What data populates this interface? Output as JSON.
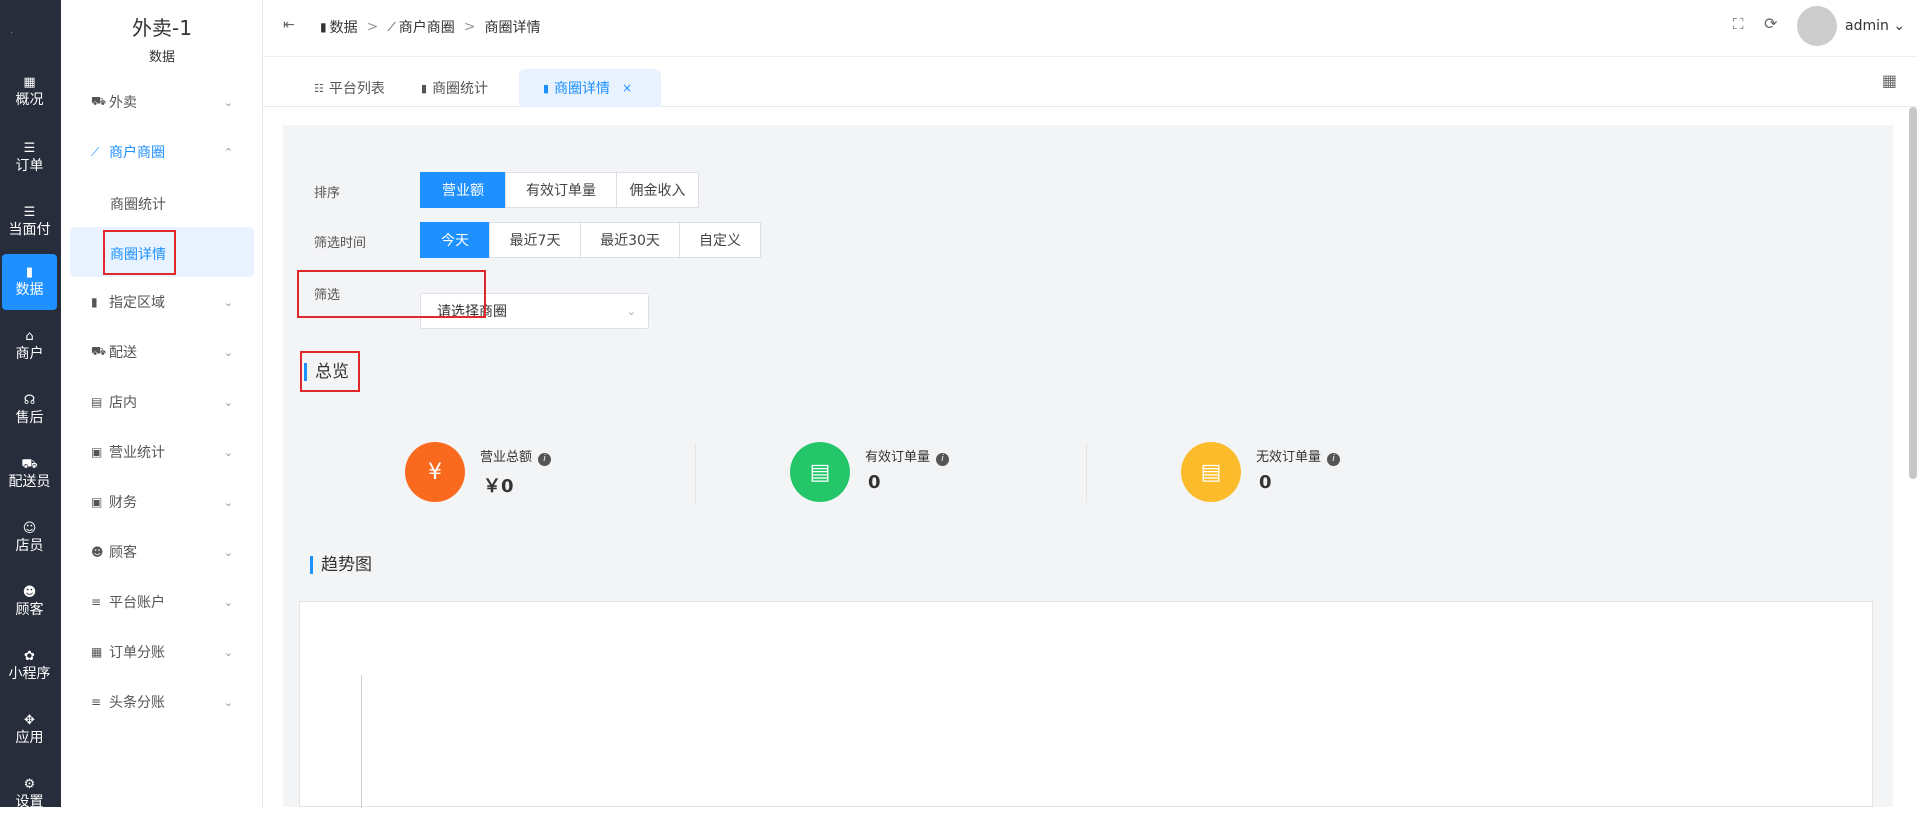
{
  "rail": {
    "items": [
      {
        "icon": "▦",
        "label": "概况"
      },
      {
        "icon": "☰",
        "label": "订单"
      },
      {
        "icon": "☰",
        "label": "当面付"
      },
      {
        "icon": "▮",
        "label": "数据"
      },
      {
        "icon": "⌂",
        "label": "商户"
      },
      {
        "icon": "☊",
        "label": "售后"
      },
      {
        "icon": "⛟",
        "label": "配送员"
      },
      {
        "icon": "☺",
        "label": "店员"
      },
      {
        "icon": "☻",
        "label": "顾客"
      },
      {
        "icon": "✿",
        "label": "小程序"
      },
      {
        "icon": "✥",
        "label": "应用"
      },
      {
        "icon": "⚙",
        "label": "设置"
      }
    ]
  },
  "sidebar": {
    "title": "外卖-1",
    "subtitle": "数据",
    "items": [
      {
        "icon": "⛟",
        "label": "外卖",
        "chevron": "⌄"
      },
      {
        "icon": "⟋",
        "label": "商户商圈",
        "chevron": "⌃"
      },
      {
        "icon": "▮",
        "label": "指定区域",
        "chevron": "⌄"
      },
      {
        "icon": "⛟",
        "label": "配送",
        "chevron": "⌄"
      },
      {
        "icon": "▤",
        "label": "店内",
        "chevron": "⌄"
      },
      {
        "icon": "▣",
        "label": "营业统计",
        "chevron": "⌄"
      },
      {
        "icon": "▣",
        "label": "财务",
        "chevron": "⌄"
      },
      {
        "icon": "☻",
        "label": "顾客",
        "chevron": "⌄"
      },
      {
        "icon": "≡",
        "label": "平台账户",
        "chevron": "⌄"
      },
      {
        "icon": "▦",
        "label": "订单分账",
        "chevron": "⌄"
      },
      {
        "icon": "≡",
        "label": "头条分账",
        "chevron": "⌄"
      }
    ],
    "subitems": [
      "商圈统计",
      "商圈详情"
    ]
  },
  "topbar": {
    "collapse_icon": "⇤",
    "breadcrumb": [
      "数据",
      "商户商圈",
      "商圈详情"
    ],
    "sep": ">",
    "fullscreen_icon": "⛶",
    "refresh_icon": "⟳",
    "user": "admin ⌄"
  },
  "tabs": {
    "items": [
      {
        "icon": "☷",
        "label": "平台列表"
      },
      {
        "icon": "▮",
        "label": "商圈统计"
      },
      {
        "icon": "▮",
        "label": "商圈详情",
        "close": "×"
      }
    ],
    "grid_icon": "▦"
  },
  "filters": {
    "sort_label": "排序",
    "sort_options": [
      "营业额",
      "有效订单量",
      "佣金收入"
    ],
    "time_label": "筛选时间",
    "time_options": [
      "今天",
      "最近7天",
      "最近30天",
      "自定义"
    ],
    "filter_label": "筛选",
    "filter_placeholder": "请选择商圈",
    "chevron": "⌄"
  },
  "overview": {
    "title": "总览",
    "stats": [
      {
        "icon": "¥",
        "label": "营业总额",
        "value": "￥0",
        "color": "#fa6a1e"
      },
      {
        "icon": "▤",
        "label": "有效订单量",
        "value": "0",
        "color": "#23c76a"
      },
      {
        "icon": "▤",
        "label": "无效订单量",
        "value": "0",
        "color": "#fbbb2a"
      }
    ],
    "info": "i"
  },
  "trend": {
    "title": "趋势图"
  }
}
